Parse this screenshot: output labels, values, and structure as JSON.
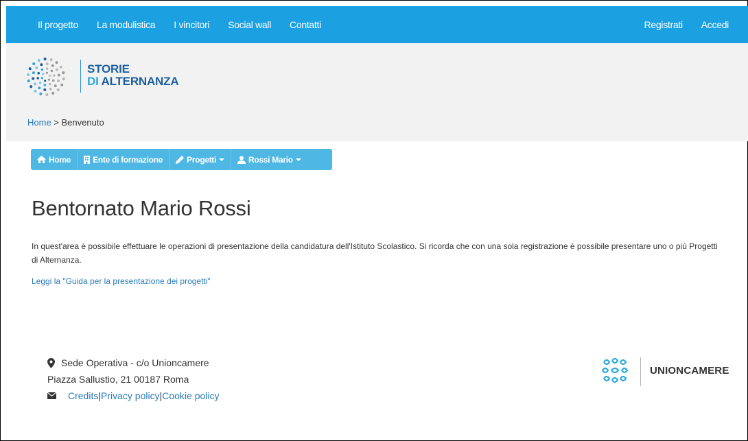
{
  "topnav": {
    "left": [
      "Il progetto",
      "La modulistica",
      "I vincitori",
      "Social wall",
      "Contatti"
    ],
    "right": [
      "Registrati",
      "Accedi"
    ]
  },
  "logo": {
    "line1": "STORIE",
    "line2_di": "DI",
    "line2_rest": " ALTERNANZA"
  },
  "breadcrumb": {
    "home": "Home",
    "sep": " > ",
    "current": "Benvenuto"
  },
  "subnav": {
    "items": [
      {
        "label": "Home",
        "icon": "home-icon"
      },
      {
        "label": "Ente di formazione",
        "icon": "building-icon"
      },
      {
        "label": "Progetti",
        "icon": "pencil-icon"
      },
      {
        "label": "Rossi Mario",
        "icon": "user-icon"
      }
    ]
  },
  "main": {
    "title": "Bentornato Mario Rossi",
    "intro": "In quest'area è possibile effettuare le operazioni di presentazione della candidatura dell'Istituto Scolastico. Si ricorda che con una sola registrazione è possibile presentare uno o più Progetti di Alternanza.",
    "guide_link": "Leggi la \"Guida per la presentazione dei progetti\""
  },
  "footer": {
    "address1": "Sede Operativa - c/o Unioncamere",
    "address2": "Piazza Sallustio, 21 00187 Roma",
    "credits": "Credits",
    "privacy": "Privacy policy",
    "cookie": "Cookie policy",
    "sep": " | ",
    "brand": "UNIONCAMERE"
  },
  "colors": {
    "accent": "#1ba1e2",
    "subnav": "#4eb7e3",
    "link": "#2a7ab8"
  }
}
